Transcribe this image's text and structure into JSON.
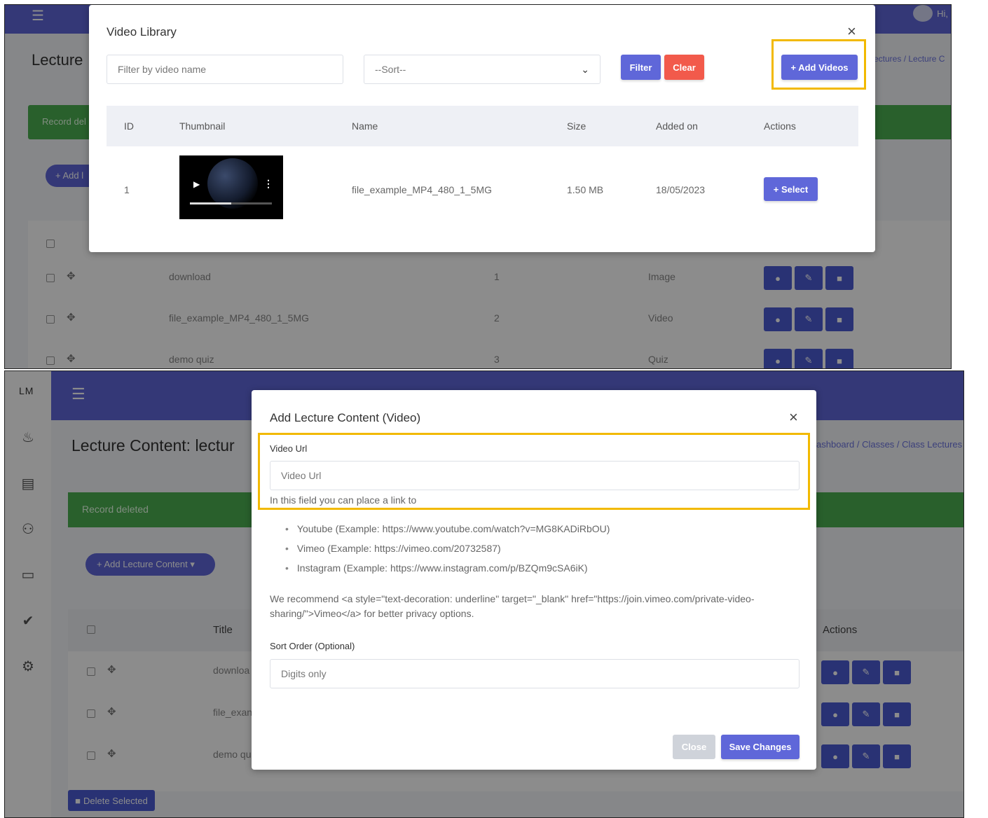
{
  "top_panel": {
    "navbar": {
      "greeting": "Hi,"
    },
    "page_title": "Lecture",
    "breadcrumb": [
      "ectures",
      "Lecture C"
    ],
    "alert": "Record del",
    "add_button": "+ Add l",
    "rows": [
      {
        "title": "download",
        "order": "1",
        "type": "Image"
      },
      {
        "title": "file_example_MP4_480_1_5MG",
        "order": "2",
        "type": "Video"
      },
      {
        "title": "demo quiz",
        "order": "3",
        "type": "Quiz"
      }
    ],
    "modal": {
      "title": "Video Library",
      "close": "×",
      "filter_placeholder": "Filter by video name",
      "sort_value": "--Sort--",
      "filter_button": "Filter",
      "clear_button": "Clear",
      "add_videos_button": "+ Add Videos",
      "columns": [
        "ID",
        "Thumbnail",
        "Name",
        "Size",
        "Added on",
        "Actions"
      ],
      "videos": [
        {
          "id": "1",
          "name": "file_example_MP4_480_1_5MG",
          "size": "1.50 MB",
          "added_on": "18/05/2023",
          "action": "+ Select"
        }
      ],
      "video_progress": 0.5
    }
  },
  "bottom_panel": {
    "brand": "LM",
    "sidebar_icons": [
      "fire-icon",
      "book-icon",
      "users-icon",
      "teacher-icon",
      "check-circle-icon",
      "cogs-icon"
    ],
    "page_title": "Lecture Content: lectur",
    "breadcrumb": [
      "ashboard",
      "Classes",
      "Class Lectures"
    ],
    "alert": "Record deleted",
    "add_button": "+ Add Lecture Content ▾",
    "table": {
      "title_header": "Title",
      "actions_header": "Actions",
      "rows": [
        "downloa",
        "file_exan",
        "demo qu"
      ]
    },
    "delete_selected": "Delete Selected",
    "modal": {
      "title": "Add Lecture Content (Video)",
      "close": "×",
      "video_url_label": "Video Url",
      "video_url_placeholder": "Video Url",
      "help_text": "In this field you can place a link to",
      "examples": [
        "Youtube (Example: https://www.youtube.com/watch?v=MG8KADiRbOU)",
        "Vimeo (Example: https://vimeo.com/20732587)",
        "Instagram (Example: https://www.instagram.com/p/BZQm9cSA6iK)"
      ],
      "recommend": "We recommend <a style=\"text-decoration: underline\" target=\"_blank\" href=\"https://join.vimeo.com/private-video-sharing/\">Vimeo</a> for better privacy options.",
      "sort_label": "Sort Order (Optional)",
      "sort_placeholder": "Digits only",
      "close_button": "Close",
      "save_button": "Save Changes"
    }
  },
  "colors": {
    "primary": "#5f67d9",
    "action_button": "#4c5bd4",
    "danger": "#f25a4b",
    "success": "#4caf50",
    "highlight": "#f2b900"
  }
}
